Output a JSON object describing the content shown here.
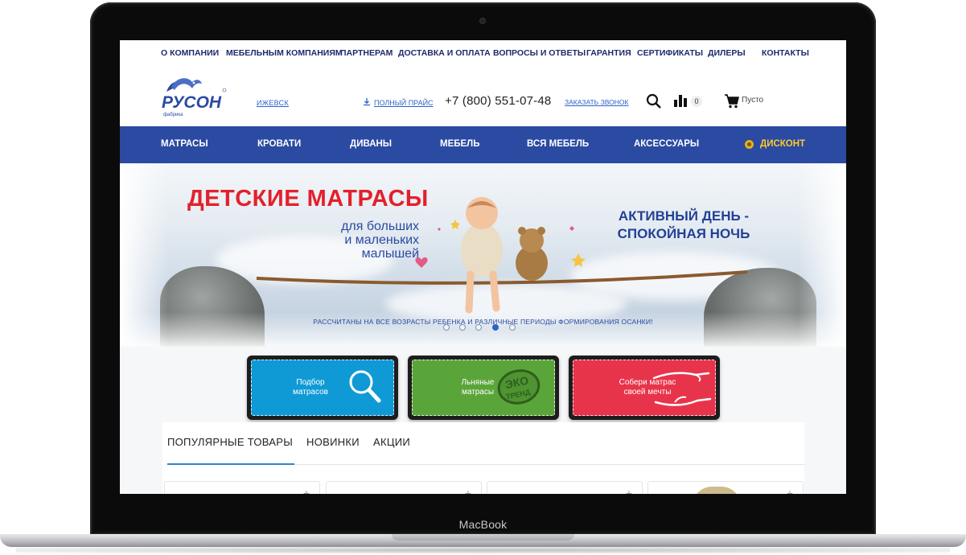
{
  "device": {
    "bezel_label": "MacBook"
  },
  "top_nav": [
    "О КОМПАНИИ",
    "МЕБЕЛЬНЫМ КОМПАНИЯМ",
    "ПАРТНЕРАМ",
    "ДОСТАВКА И ОПЛАТА",
    "ВОПРОСЫ И ОТВЕТЫ",
    "ГАРАНТИЯ",
    "СЕРТИФИКАТЫ",
    "ДИЛЕРЫ",
    "КОНТАКТЫ"
  ],
  "header": {
    "logo_text": "РУСОН",
    "logo_sub": "фабрика",
    "city": "ИЖЕВСК",
    "price_link": "ПОЛНЫЙ ПРАЙС",
    "phone": "+7 (800) 551-07-48",
    "callback": "ЗАКАЗАТЬ ЗВОНОК",
    "compare_count": "0",
    "cart_text": "Пусто"
  },
  "categories": [
    "МАТРАСЫ",
    "КРОВАТИ",
    "ДИВАНЫ",
    "МЕБЕЛЬ",
    "ВСЯ МЕБЕЛЬ",
    "АКСЕССУАРЫ",
    "ДИСКОНТ"
  ],
  "banner": {
    "title": "ДЕТСКИЕ МАТРАСЫ",
    "subtitle_lines": [
      "для больших",
      "и маленьких",
      "малышей"
    ],
    "slogan_lines": [
      "АКТИВНЫЙ ДЕНЬ -",
      "СПОКОЙНАЯ НОЧЬ"
    ],
    "note": "РАССЧИТАНЫ НА ВСЕ ВОЗРАСТЫ РЕБЕНКА И РАЗЛИЧНЫЕ ПЕРИОДЫ ФОРМИРОВАНИЯ ОСАНКИ!",
    "slides": 5,
    "active_slide": 4
  },
  "promo_tiles": [
    {
      "lines": [
        "Подбор",
        "матрасов"
      ],
      "color": "#0f9ad6",
      "icon": "magnifier-icon"
    },
    {
      "lines": [
        "Льняные",
        "матрасы"
      ],
      "color": "#5aa53a",
      "icon": "eco-trend-stamp-icon",
      "stamp": "ЭКО ТРЕНД"
    },
    {
      "lines": [
        "Собери матрас",
        "своей мечты"
      ],
      "color": "#e8344b",
      "icon": "hands-icon"
    }
  ],
  "tabs": [
    "ПОПУЛЯРНЫЕ ТОВАРЫ",
    "НОВИНКИ",
    "АКЦИИ"
  ],
  "colors": {
    "brand_blue": "#2b4aa2",
    "nav_text": "#1d2a6e",
    "link_blue": "#2d63c8",
    "banner_red": "#e3202c",
    "discount_yellow": "#ffcb2b",
    "tab_accent": "#2a86c9"
  }
}
